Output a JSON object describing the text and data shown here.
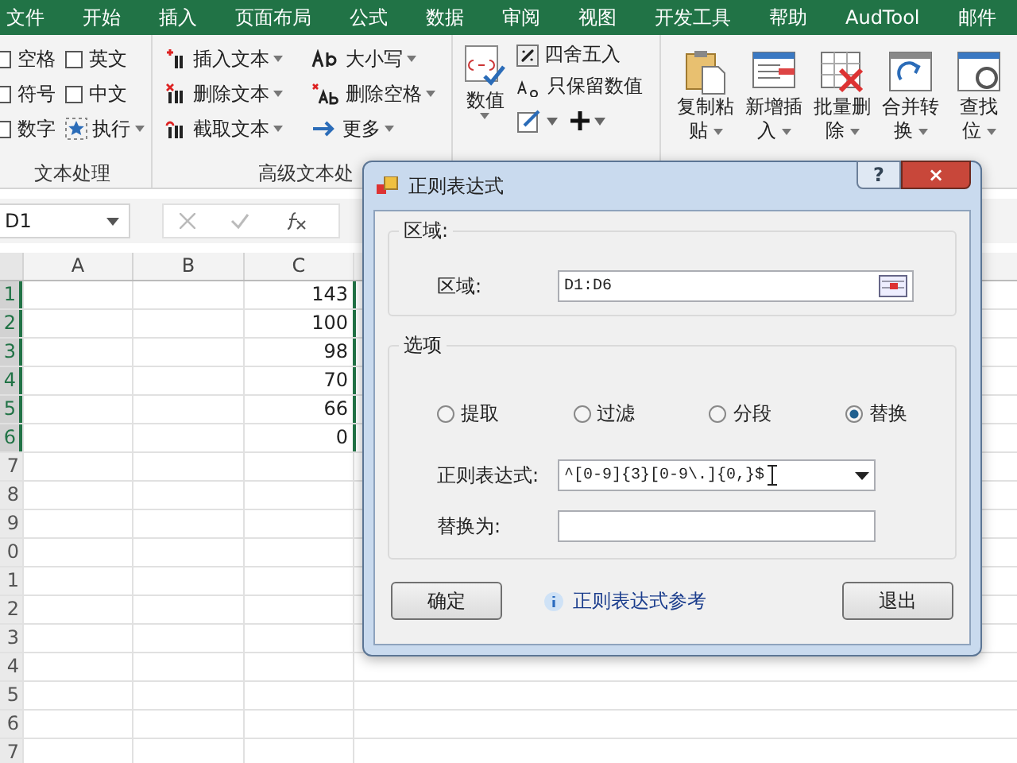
{
  "tabs": [
    {
      "label": "文件"
    },
    {
      "label": "开始"
    },
    {
      "label": "插入"
    },
    {
      "label": "页面布局"
    },
    {
      "label": "公式"
    },
    {
      "label": "数据"
    },
    {
      "label": "审阅"
    },
    {
      "label": "视图"
    },
    {
      "label": "开发工具"
    },
    {
      "label": "帮助"
    },
    {
      "label": "AudTool"
    },
    {
      "label": "邮件"
    }
  ],
  "ribbon": {
    "text_group": {
      "checkboxes": [
        {
          "label": "空格",
          "checked": false
        },
        {
          "label": "符号",
          "checked": false
        },
        {
          "label": "数字",
          "checked": false
        },
        {
          "label": "英文",
          "checked": false
        },
        {
          "label": "中文",
          "checked": false
        }
      ],
      "run_button": "执行",
      "label": "文本处理"
    },
    "advanced_group": {
      "buttons": [
        {
          "label": "插入文本",
          "kind": "insert"
        },
        {
          "label": "删除文本",
          "kind": "delete"
        },
        {
          "label": "截取文本",
          "kind": "cut"
        },
        {
          "label": "大小写",
          "kind": "case"
        },
        {
          "label": "删除空格",
          "kind": "space"
        },
        {
          "label": "更多",
          "kind": "more"
        }
      ],
      "label": "高级文本处"
    },
    "number_group": {
      "big_button": "数值",
      "small_buttons": [
        {
          "label": "四舍五入",
          "kind": "round"
        },
        {
          "label": "只保留数值",
          "kind": "keep"
        }
      ]
    },
    "edit_group": {
      "buttons": [
        {
          "line1": "复制粘",
          "line2": "贴",
          "kind": "paste"
        },
        {
          "line1": "新增插",
          "line2": "入",
          "kind": "insert"
        },
        {
          "line1": "批量删",
          "line2": "除",
          "kind": "delete"
        },
        {
          "line1": "合并转",
          "line2": "换",
          "kind": "merge"
        },
        {
          "line1": "查找",
          "line2": "位",
          "kind": "find"
        }
      ]
    }
  },
  "formula_bar": {
    "name_box": "D1"
  },
  "sheet": {
    "columns": [
      "A",
      "B",
      "C"
    ],
    "rows": [
      {
        "number": "1",
        "selected": true,
        "column_c": "143"
      },
      {
        "number": "2",
        "selected": true,
        "column_c": "100"
      },
      {
        "number": "3",
        "selected": true,
        "column_c": "98"
      },
      {
        "number": "4",
        "selected": true,
        "column_c": "70"
      },
      {
        "number": "5",
        "selected": true,
        "column_c": "66"
      },
      {
        "number": "6",
        "selected": true,
        "column_c": "0"
      },
      {
        "number": "7",
        "selected": false,
        "column_c": ""
      },
      {
        "number": "8",
        "selected": false,
        "column_c": ""
      },
      {
        "number": "9",
        "selected": false,
        "column_c": ""
      },
      {
        "number": "0",
        "selected": false,
        "column_c": ""
      },
      {
        "number": "1",
        "selected": false,
        "column_c": ""
      },
      {
        "number": "2",
        "selected": false,
        "column_c": ""
      },
      {
        "number": "3",
        "selected": false,
        "column_c": ""
      },
      {
        "number": "4",
        "selected": false,
        "column_c": ""
      },
      {
        "number": "5",
        "selected": false,
        "column_c": ""
      },
      {
        "number": "6",
        "selected": false,
        "column_c": ""
      },
      {
        "number": "7",
        "selected": false,
        "column_c": ""
      }
    ]
  },
  "dialog": {
    "title": "正则表达式",
    "help_button": "?",
    "close_button": "×",
    "range_group": {
      "legend": "区域:",
      "label": "区域:",
      "value": "D1:D6"
    },
    "options_group": {
      "legend": "选项",
      "modes": [
        {
          "label": "提取",
          "selected": false
        },
        {
          "label": "过滤",
          "selected": false
        },
        {
          "label": "分段",
          "selected": false
        },
        {
          "label": "替换",
          "selected": true
        }
      ],
      "regex_label": "正则表达式:",
      "regex_value": "^[0-9]{3}[0-9\\.]{0,}$",
      "replace_label": "替换为:"
    },
    "ok_button": "确定",
    "reference_link": "正则表达式参考",
    "exit_button": "退出"
  }
}
